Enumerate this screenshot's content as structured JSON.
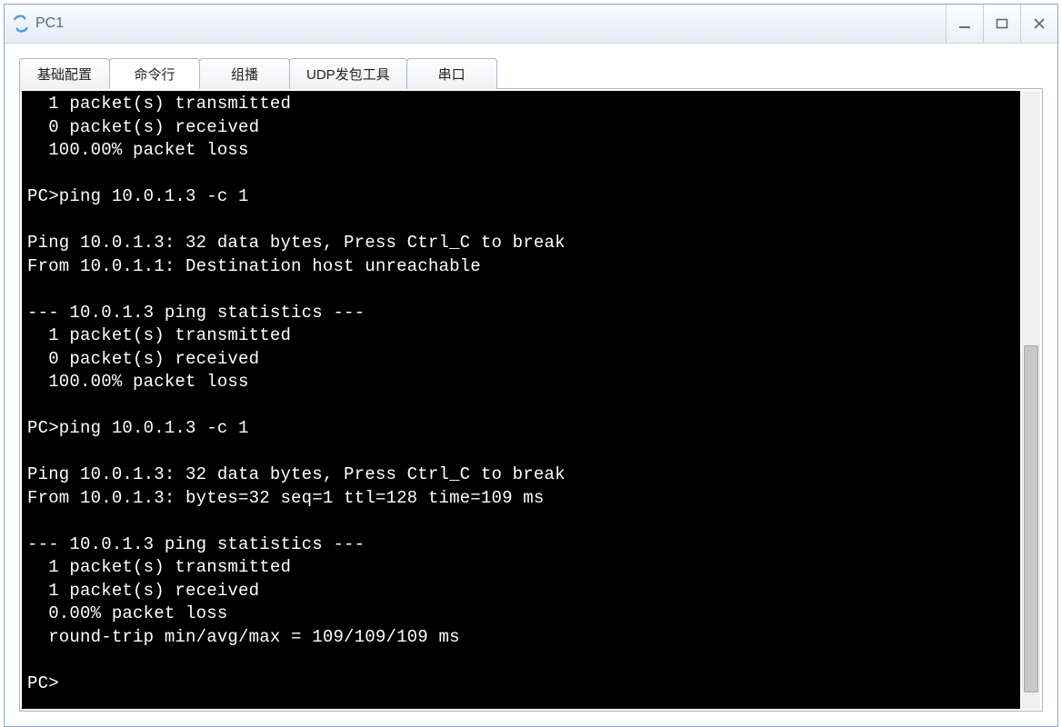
{
  "window": {
    "title": "PC1"
  },
  "tabs": [
    {
      "label": "基础配置",
      "active": false
    },
    {
      "label": "命令行",
      "active": true
    },
    {
      "label": "组播",
      "active": false
    },
    {
      "label": "UDP发包工具",
      "active": false
    },
    {
      "label": "串口",
      "active": false
    }
  ],
  "terminal_lines": [
    "  1 packet(s) transmitted",
    "  0 packet(s) received",
    "  100.00% packet loss",
    "",
    "PC>ping 10.0.1.3 -c 1",
    "",
    "Ping 10.0.1.3: 32 data bytes, Press Ctrl_C to break",
    "From 10.0.1.1: Destination host unreachable",
    "",
    "--- 10.0.1.3 ping statistics ---",
    "  1 packet(s) transmitted",
    "  0 packet(s) received",
    "  100.00% packet loss",
    "",
    "PC>ping 10.0.1.3 -c 1",
    "",
    "Ping 10.0.1.3: 32 data bytes, Press Ctrl_C to break",
    "From 10.0.1.3: bytes=32 seq=1 ttl=128 time=109 ms",
    "",
    "--- 10.0.1.3 ping statistics ---",
    "  1 packet(s) transmitted",
    "  1 packet(s) received",
    "  0.00% packet loss",
    "  round-trip min/avg/max = 109/109/109 ms",
    "",
    "PC>"
  ]
}
